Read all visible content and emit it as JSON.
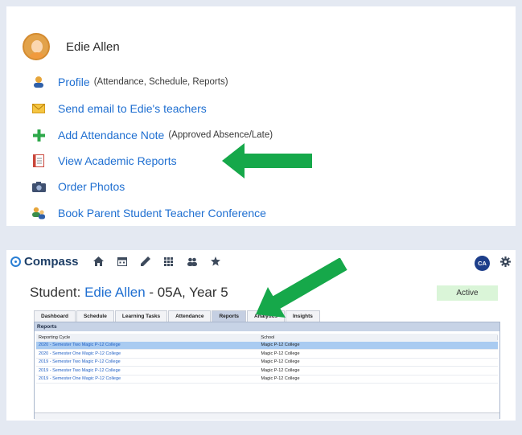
{
  "profile": {
    "name": "Edie Allen",
    "menu": [
      {
        "label": "Profile",
        "sub": "(Attendance, Schedule, Reports)",
        "icon": "person-icon"
      },
      {
        "label": "Send email to Edie's teachers",
        "sub": "",
        "icon": "envelope-icon"
      },
      {
        "label": "Add Attendance Note",
        "sub": "(Approved Absence/Late)",
        "icon": "plus-icon"
      },
      {
        "label": "View Academic Reports",
        "sub": "",
        "icon": "report-icon"
      },
      {
        "label": "Order Photos",
        "sub": "",
        "icon": "camera-icon"
      },
      {
        "label": "Book Parent Student Teacher Conference",
        "sub": "",
        "icon": "conference-icon"
      }
    ]
  },
  "compass": {
    "logo": "Compass",
    "user_initials": "CA",
    "student_prefix": "Student: ",
    "student_name": "Edie Allen",
    "student_suffix": " - 05A, Year 5",
    "status": "Active",
    "tabs": [
      "Dashboard",
      "Schedule",
      "Learning Tasks",
      "Attendance",
      "Reports",
      "Analytics",
      "Insights"
    ],
    "active_tab": "Reports",
    "reports": {
      "title": "Reports",
      "columns": [
        "Reporting Cycle",
        "School"
      ],
      "rows": [
        [
          "2020 - Semester Two Magic P-12 College",
          "Magic P-12 College"
        ],
        [
          "2020 - Semester One Magic P-12 College",
          "Magic P-12 College"
        ],
        [
          "2019 - Semester Two Magic P-12 College",
          "Magic P-12 College"
        ],
        [
          "2019 - Semester Two Magic P-12 College",
          "Magic P-12 College"
        ],
        [
          "2019 - Semester One Magic P-12 College",
          "Magic P-12 College"
        ]
      ]
    }
  },
  "colors": {
    "link": "#1f6fd1",
    "arrow": "#16a84a",
    "selected_row": "#a9cbf1"
  }
}
